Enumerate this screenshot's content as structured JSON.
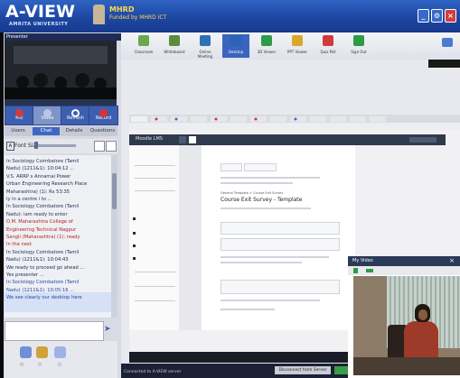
{
  "header": {
    "app_name": "A-VIEW",
    "org_line": "AMRITA UNIVERSITY",
    "ministry": "MHRD",
    "funded_by": "Funded by MHRD ICT",
    "window_buttons": [
      "minimize-icon",
      "settings-icon",
      "close-icon"
    ]
  },
  "presenter": {
    "label": "Presenter"
  },
  "controls": [
    {
      "label": "Mic",
      "icon": "mic-icon",
      "color": "#d23b3b"
    },
    {
      "label": "Video",
      "icon": "video-icon",
      "color": "#8fa7df"
    },
    {
      "label": "Refresh",
      "icon": "refresh-icon",
      "color": "#ffffff"
    },
    {
      "label": "Record",
      "icon": "record-icon",
      "color": "#e03030"
    }
  ],
  "tabs": [
    {
      "label": "Users",
      "active": false
    },
    {
      "label": "Chat",
      "active": true
    },
    {
      "label": "Details",
      "active": false
    },
    {
      "label": "Questions",
      "active": false
    }
  ],
  "font_size": {
    "label": "Font Size"
  },
  "chat": {
    "messages": [
      {
        "text": "ln Sociology Coimbatore (Tamil",
        "tone": "dark"
      },
      {
        "text": "Nadu) (1211&1): 10:04:12 ...",
        "tone": "dark"
      },
      {
        "text": "V.S. ARRP s Annamai Power",
        "tone": "dark"
      },
      {
        "text": "Urban Engineering Research Place",
        "tone": "dark"
      },
      {
        "text": "Maharashtra) (1): Rs 53:35",
        "tone": "dark"
      },
      {
        "text": "ly in a centre i to ...",
        "tone": "dark"
      },
      {
        "text": "ln Sociology Coimbatore (Tamil",
        "tone": "dark"
      },
      {
        "text": "Nadu): iam ready to enter",
        "tone": "dark"
      },
      {
        "text": "O.M. Maharashtra College of",
        "tone": "red"
      },
      {
        "text": "Engineering Technical Nagpur",
        "tone": "red"
      },
      {
        "text": "Sangli (Maharashtra) (1): ready",
        "tone": "red"
      },
      {
        "text": "ln the next",
        "tone": "red"
      },
      {
        "text": "ln Sociology Coimbatore (Tamil",
        "tone": "dark"
      },
      {
        "text": "Nadu) (1211&1): 10:04:43",
        "tone": "dark"
      },
      {
        "text": "We ready to proceed go ahead ...",
        "tone": "dark"
      },
      {
        "text": "Yes presenter ...",
        "tone": "dark"
      },
      {
        "text": "ln Sociology Coimbatore (Tamil",
        "tone": "blue"
      },
      {
        "text": "Nadu) (1211&1): 10:05:16 ...",
        "tone": "blue"
      },
      {
        "text": "We see clearly our desktop here",
        "tone": "blue"
      }
    ],
    "input_placeholder": ""
  },
  "toolbar": {
    "items": [
      {
        "label": "Classroom",
        "icon": "classroom-icon",
        "color": "#6aa84f"
      },
      {
        "label": "Whiteboard",
        "icon": "whiteboard-icon",
        "color": "#5b8d3c"
      },
      {
        "label": "Online Meeting",
        "icon": "meeting-icon",
        "color": "#2f6fb3"
      },
      {
        "label": "Desktop",
        "icon": "desktop-icon",
        "color": "#2a63b5"
      },
      {
        "label": "3D Viewer",
        "icon": "viewer-3d-icon",
        "color": "#2e9a4a"
      },
      {
        "label": "PPT Viewer",
        "icon": "ppt-icon",
        "color": "#d9a62e"
      },
      {
        "label": "Quiz Poll",
        "icon": "quiz-icon",
        "color": "#d23b3b"
      },
      {
        "label": "Sign Out",
        "icon": "signout-icon",
        "color": "#2f9a48"
      }
    ]
  },
  "shared_desktop": {
    "logo": "Moodle LMS",
    "course_title": "Course Exit Survey - Template",
    "course_breadcrumb": "General Template  >  Course Exit Survey"
  },
  "video_chat": {
    "title": "My Video"
  },
  "status_bar": {
    "left_text": "Connected to A-VIEW server",
    "button_label": "Disconnect from Server"
  }
}
